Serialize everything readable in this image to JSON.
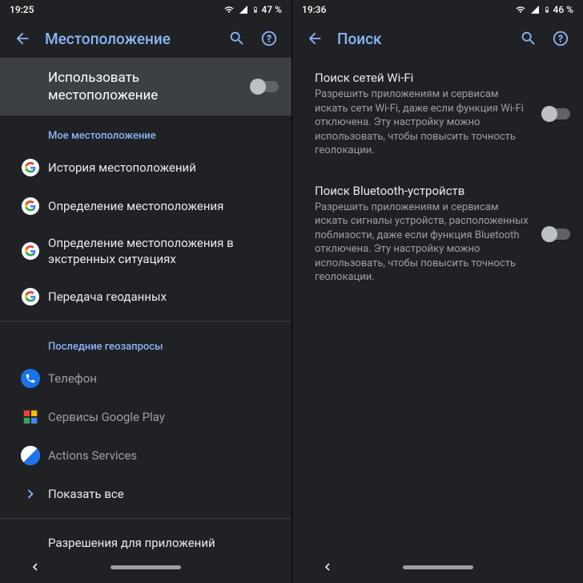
{
  "left": {
    "status": {
      "time": "19:25",
      "battery": "47 %"
    },
    "appbar_title": "Местоположение",
    "use_location": "Использовать местоположение",
    "sec_my": "Мое местоположение",
    "items_my": [
      "История местоположений",
      "Определение местоположения",
      "Определение местоположения в экстренных ситуациях",
      "Передача геоданных"
    ],
    "sec_recent": "Последние геозапросы",
    "items_recent": [
      "Телефон",
      "Сервисы Google Play",
      "Actions Services"
    ],
    "show_all": "Показать все",
    "app_permissions": "Разрешения для приложений"
  },
  "right": {
    "status": {
      "time": "19:36",
      "battery": "46 %"
    },
    "appbar_title": "Поиск",
    "wifi": {
      "title": "Поиск сетей Wi-Fi",
      "desc": "Разрешить приложениям и сервисам искать сети Wi-Fi, даже если функция Wi-Fi отключена. Эту настройку можно использовать, чтобы повысить точность геолокации."
    },
    "bt": {
      "title": "Поиск Bluetooth-устройств",
      "desc": "Разрешить приложениям и сервисам искать сигналы устройств, расположенных поблизости, даже если функция Bluetooth отключена. Эту настройку можно использовать, чтобы повысить точность геолокации."
    }
  }
}
